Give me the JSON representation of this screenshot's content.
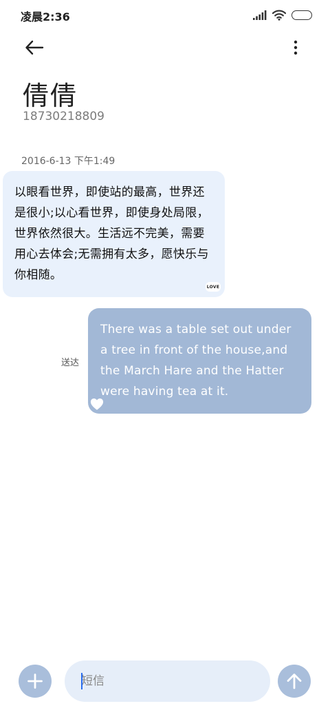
{
  "status_bar": {
    "time": "凌晨2:36"
  },
  "header": {
    "back_icon": "back-arrow-icon",
    "more_icon": "more-vertical-icon",
    "contact_name": "倩倩",
    "contact_number": "18730218809"
  },
  "conversation": {
    "timestamp": "2016-6-13 下午1:49",
    "incoming": {
      "text": "以眼看世界，即使站的最高，世界还是很小;以心看世界，即使身处局限，世界依然很大。生活远不完美，需要用心去体会;无需拥有太多，愿快乐与你相随。",
      "sticker": "LOVE",
      "bubble_color": "#e9f1fc"
    },
    "outgoing": {
      "status": "送达",
      "text": "There was a table set out under a tree in front of the house,and the March Hare and the Hatter were having tea at it.",
      "sticker_icon": "heart-icon",
      "bubble_color": "#a2b8d6"
    }
  },
  "composer": {
    "add_icon": "plus-icon",
    "placeholder": "短信",
    "value": "",
    "send_icon": "send-arrow-icon",
    "button_color": "#a9bedb"
  }
}
